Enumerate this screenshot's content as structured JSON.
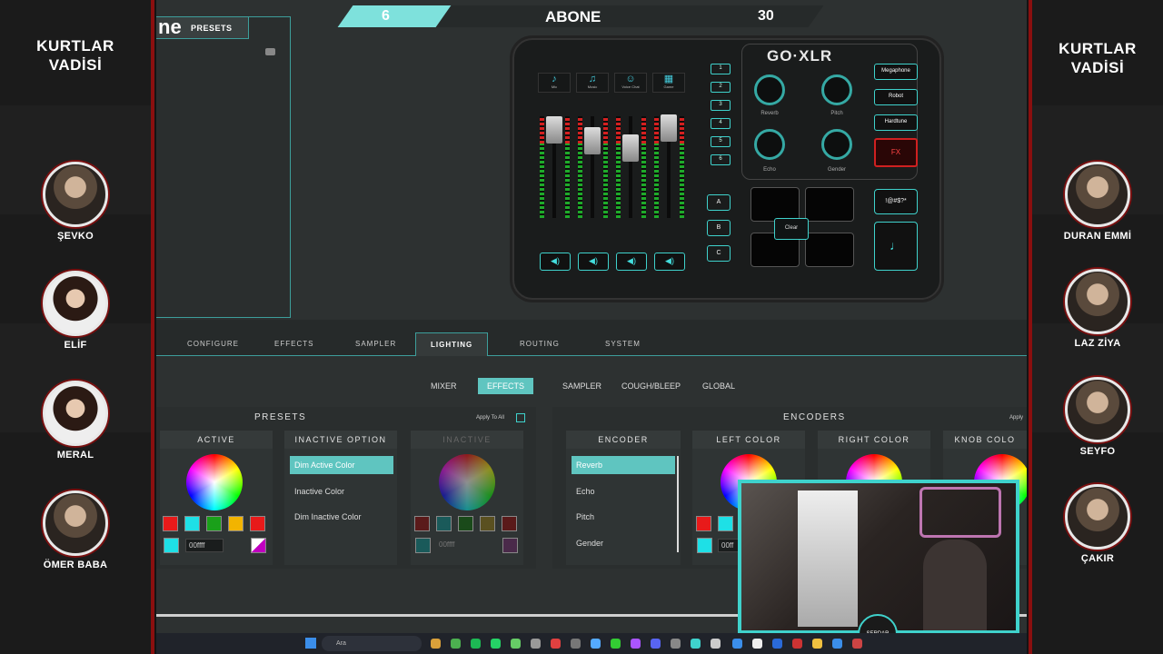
{
  "left_panel": {
    "title_line1": "KURTLAR",
    "title_line2": "VADİSİ",
    "characters": [
      {
        "name": "ŞEVKO"
      },
      {
        "name": "ELİF"
      },
      {
        "name": "MERAL"
      },
      {
        "name": "ÖMER BABA"
      }
    ]
  },
  "right_panel": {
    "title_line1": "KURTLAR",
    "title_line2": "VADİSİ",
    "characters": [
      {
        "name": "DURAN EMMİ"
      },
      {
        "name": "LAZ ZİYA"
      },
      {
        "name": "SEYFO"
      },
      {
        "name": "ÇAKIR"
      }
    ]
  },
  "banner": {
    "left_count": "6",
    "label": "ABONE",
    "right_count": "30"
  },
  "presets_panel": {
    "logo_fragment": "ne",
    "tab_label": "PRESETS"
  },
  "device": {
    "brand": "GO·XLR",
    "channels": [
      {
        "label": "Mic",
        "icon": "microphone-icon"
      },
      {
        "label": "Music",
        "icon": "music-note-icon"
      },
      {
        "label": "Voice Chat",
        "icon": "voice-chat-icon"
      },
      {
        "label": "Game",
        "icon": "game-icon"
      }
    ],
    "preset_numbers": [
      "1",
      "2",
      "3",
      "4",
      "5",
      "6"
    ],
    "knobs": [
      {
        "label": "Reverb"
      },
      {
        "label": "Pitch"
      },
      {
        "label": "Echo"
      },
      {
        "label": "Gender"
      }
    ],
    "fx_buttons": [
      "Megaphone",
      "Robot",
      "Hardtune"
    ],
    "fx_toggle": "FX",
    "sampler_banks": [
      "A",
      "B",
      "C"
    ],
    "clear_label": "Clear",
    "bleep_label": "!@#$?*"
  },
  "main_tabs": [
    {
      "label": "CONFIGURE",
      "active": false
    },
    {
      "label": "EFFECTS",
      "active": false
    },
    {
      "label": "SAMPLER",
      "active": false
    },
    {
      "label": "LIGHTING",
      "active": true
    },
    {
      "label": "ROUTING",
      "active": false
    },
    {
      "label": "SYSTEM",
      "active": false
    }
  ],
  "sub_tabs": [
    {
      "label": "MIXER",
      "active": false
    },
    {
      "label": "EFFECTS",
      "active": true
    },
    {
      "label": "SAMPLER",
      "active": false
    },
    {
      "label": "COUGH/BLEEP",
      "active": false
    },
    {
      "label": "GLOBAL",
      "active": false
    }
  ],
  "presets_section": {
    "title": "PRESETS",
    "apply_to_all": "Apply To All",
    "active": {
      "header": "ACTIVE",
      "hex": "00ffff"
    },
    "inactive_option": {
      "header": "INACTIVE OPTION",
      "options": [
        "Dim Active Color",
        "Inactive Color",
        "Dim Inactive Color"
      ],
      "selected": "Dim Active Color"
    },
    "inactive": {
      "header": "INACTIVE",
      "hex": "00ffff"
    }
  },
  "encoders_section": {
    "title": "ENCODERS",
    "apply_to_all": "Apply",
    "encoder": {
      "header": "ENCODER",
      "options": [
        "Reverb",
        "Echo",
        "Pitch",
        "Gender"
      ],
      "selected": "Reverb"
    },
    "left_color": {
      "header": "LEFT COLOR",
      "hex": "00ff"
    },
    "right_color": {
      "header": "RIGHT COLOR"
    },
    "knob_color": {
      "header": "KNOB COLO"
    }
  },
  "swatch_colors": [
    "#e81a1a",
    "#1ee0e6",
    "#1aa01a",
    "#f2b400",
    "#e81a1a"
  ],
  "accent_color": "#5fc5c0",
  "webcam_logo": "SERDAR",
  "taskbar": {
    "search_placeholder": "Ara"
  }
}
